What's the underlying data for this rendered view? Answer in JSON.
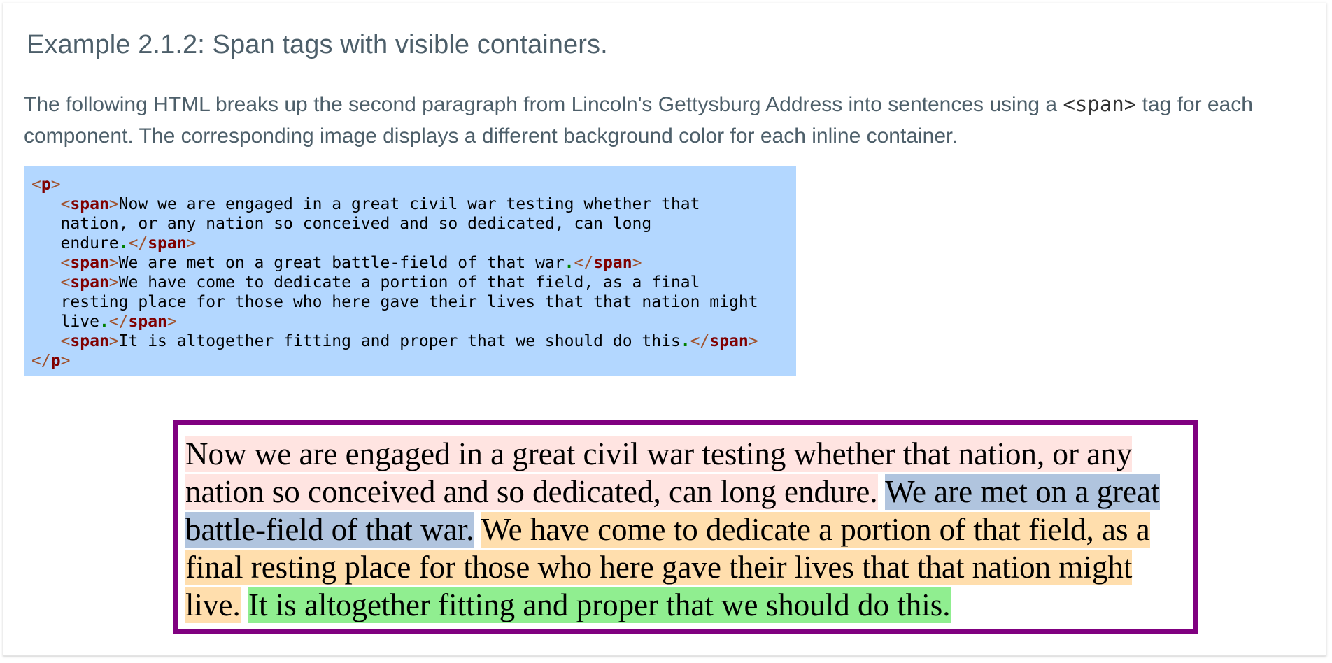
{
  "example": {
    "title": "Example 2.1.2: Span tags with visible containers.",
    "intro_before": "The following HTML breaks up the second paragraph from Lincoln's Gettysburg Address into sentences using a ",
    "intro_code": "<span>",
    "intro_after": " tag for each component. The corresponding image displays a different background color for each inline container."
  },
  "code": {
    "p_open": "p",
    "span_tag": "span",
    "line1": "Now we are engaged in a great civil war testing whether that",
    "line2": "nation, or any nation so conceived and so dedicated, can long",
    "line3": "endure",
    "line4": "We are met on a great battle-field of that war",
    "line5": "We have come to dedicate a portion of that field, as a final",
    "line6": "resting place for those who here gave their lives that that nation might",
    "line7": "live",
    "line8": "It is altogether fitting and proper that we should do this",
    "dot": "."
  },
  "rendered": {
    "sentences": [
      {
        "text": "Now we are engaged in a great civil war testing whether that nation, or any nation so conceived and so dedicated, can long endure.",
        "color": "#ffe4e1"
      },
      {
        "text": "We are met on a great battle-field of that war.",
        "color": "#b0c4de"
      },
      {
        "text": "We have come to dedicate a portion of that field, as a final resting place for those who here gave their lives that that nation might live.",
        "color": "#ffdead"
      },
      {
        "text": "It is altogether fitting and proper that we should do this.",
        "color": "#90ee90"
      }
    ],
    "border_color": "#800080"
  },
  "colors": {
    "text": "#4d5f6a",
    "code_background": "#b3d7ff",
    "tag_name": "#800000",
    "tag_bracket": "#a0522d",
    "punctuation": "#008000"
  }
}
